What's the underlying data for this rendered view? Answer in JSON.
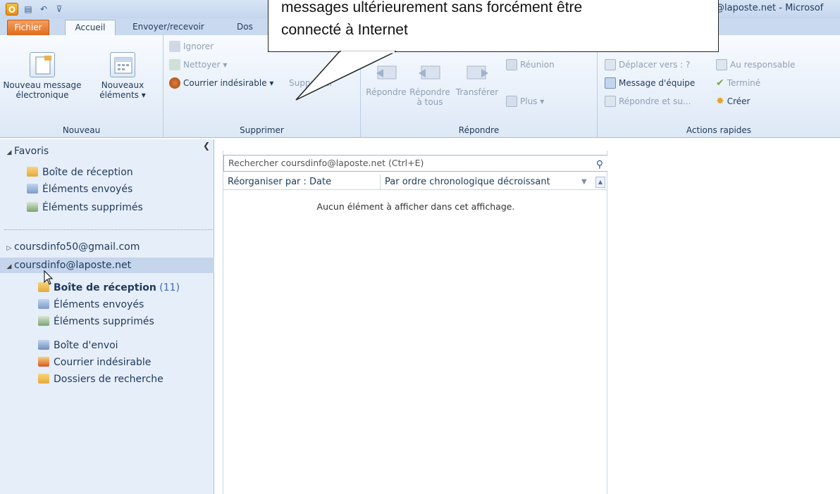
{
  "window": {
    "title": "@laposte.net - Microsof",
    "app_icon": "O"
  },
  "quick_access": {
    "save_icon": "save-icon",
    "undo_icon": "undo-icon",
    "customize_icon": "customize-icon"
  },
  "tabs": [
    {
      "label": "Fichier"
    },
    {
      "label": "Accueil"
    },
    {
      "label": "Envoyer/recevoir"
    },
    {
      "label": "Dos"
    }
  ],
  "callout": {
    "line1": "messages ultérieurement sans forcément être",
    "line2": "connecté à Internet"
  },
  "ribbon": {
    "nouveau": {
      "label": "Nouveau",
      "new_message_1": "Nouveau message",
      "new_message_2": "électronique",
      "new_items_1": "Nouveaux",
      "new_items_2": "éléments ▾"
    },
    "supprimer": {
      "label": "Supprimer",
      "ignorer": "Ignorer",
      "nettoyer": "Nettoyer ▾",
      "junk": "Courrier indésirable ▾",
      "delete": "Supprimer"
    },
    "repondre": {
      "label": "Répondre",
      "reply": "Répondre",
      "reply_all_1": "Répondre",
      "reply_all_2": "à tous",
      "forward": "Transférer",
      "meeting": "Réunion",
      "more": "Plus ▾"
    },
    "actions_rapides": {
      "label": "Actions rapides",
      "move_to": "Déplacer vers : ?",
      "manager": "Au responsable",
      "team_email": "Message d'équipe",
      "done": "Terminé",
      "reply_delete": "Répondre et su...",
      "create": "Créer"
    }
  },
  "nav": {
    "favorites_label": "Favoris",
    "favorites": [
      {
        "label": "Boîte de réception"
      },
      {
        "label": "Éléments envoyés"
      },
      {
        "label": "Éléments supprimés"
      }
    ],
    "accounts": [
      {
        "label": "coursdinfo50@gmail.com"
      },
      {
        "label": "coursdinfo@laposte.net"
      }
    ],
    "account_folders": [
      {
        "label": "Boîte de réception",
        "count": "(11)"
      },
      {
        "label": "Éléments envoyés"
      },
      {
        "label": "Éléments supprimés"
      },
      {
        "label": "Boîte d'envoi"
      },
      {
        "label": "Courrier indésirable"
      },
      {
        "label": "Dossiers de recherche"
      }
    ]
  },
  "mail_list": {
    "search_placeholder": "Rechercher coursdinfo@laposte.net (Ctrl+E)",
    "sort_by": "Réorganiser par : Date",
    "order": "Par ordre chronologique décroissant",
    "empty": "Aucun élément à afficher dans cet affichage."
  }
}
